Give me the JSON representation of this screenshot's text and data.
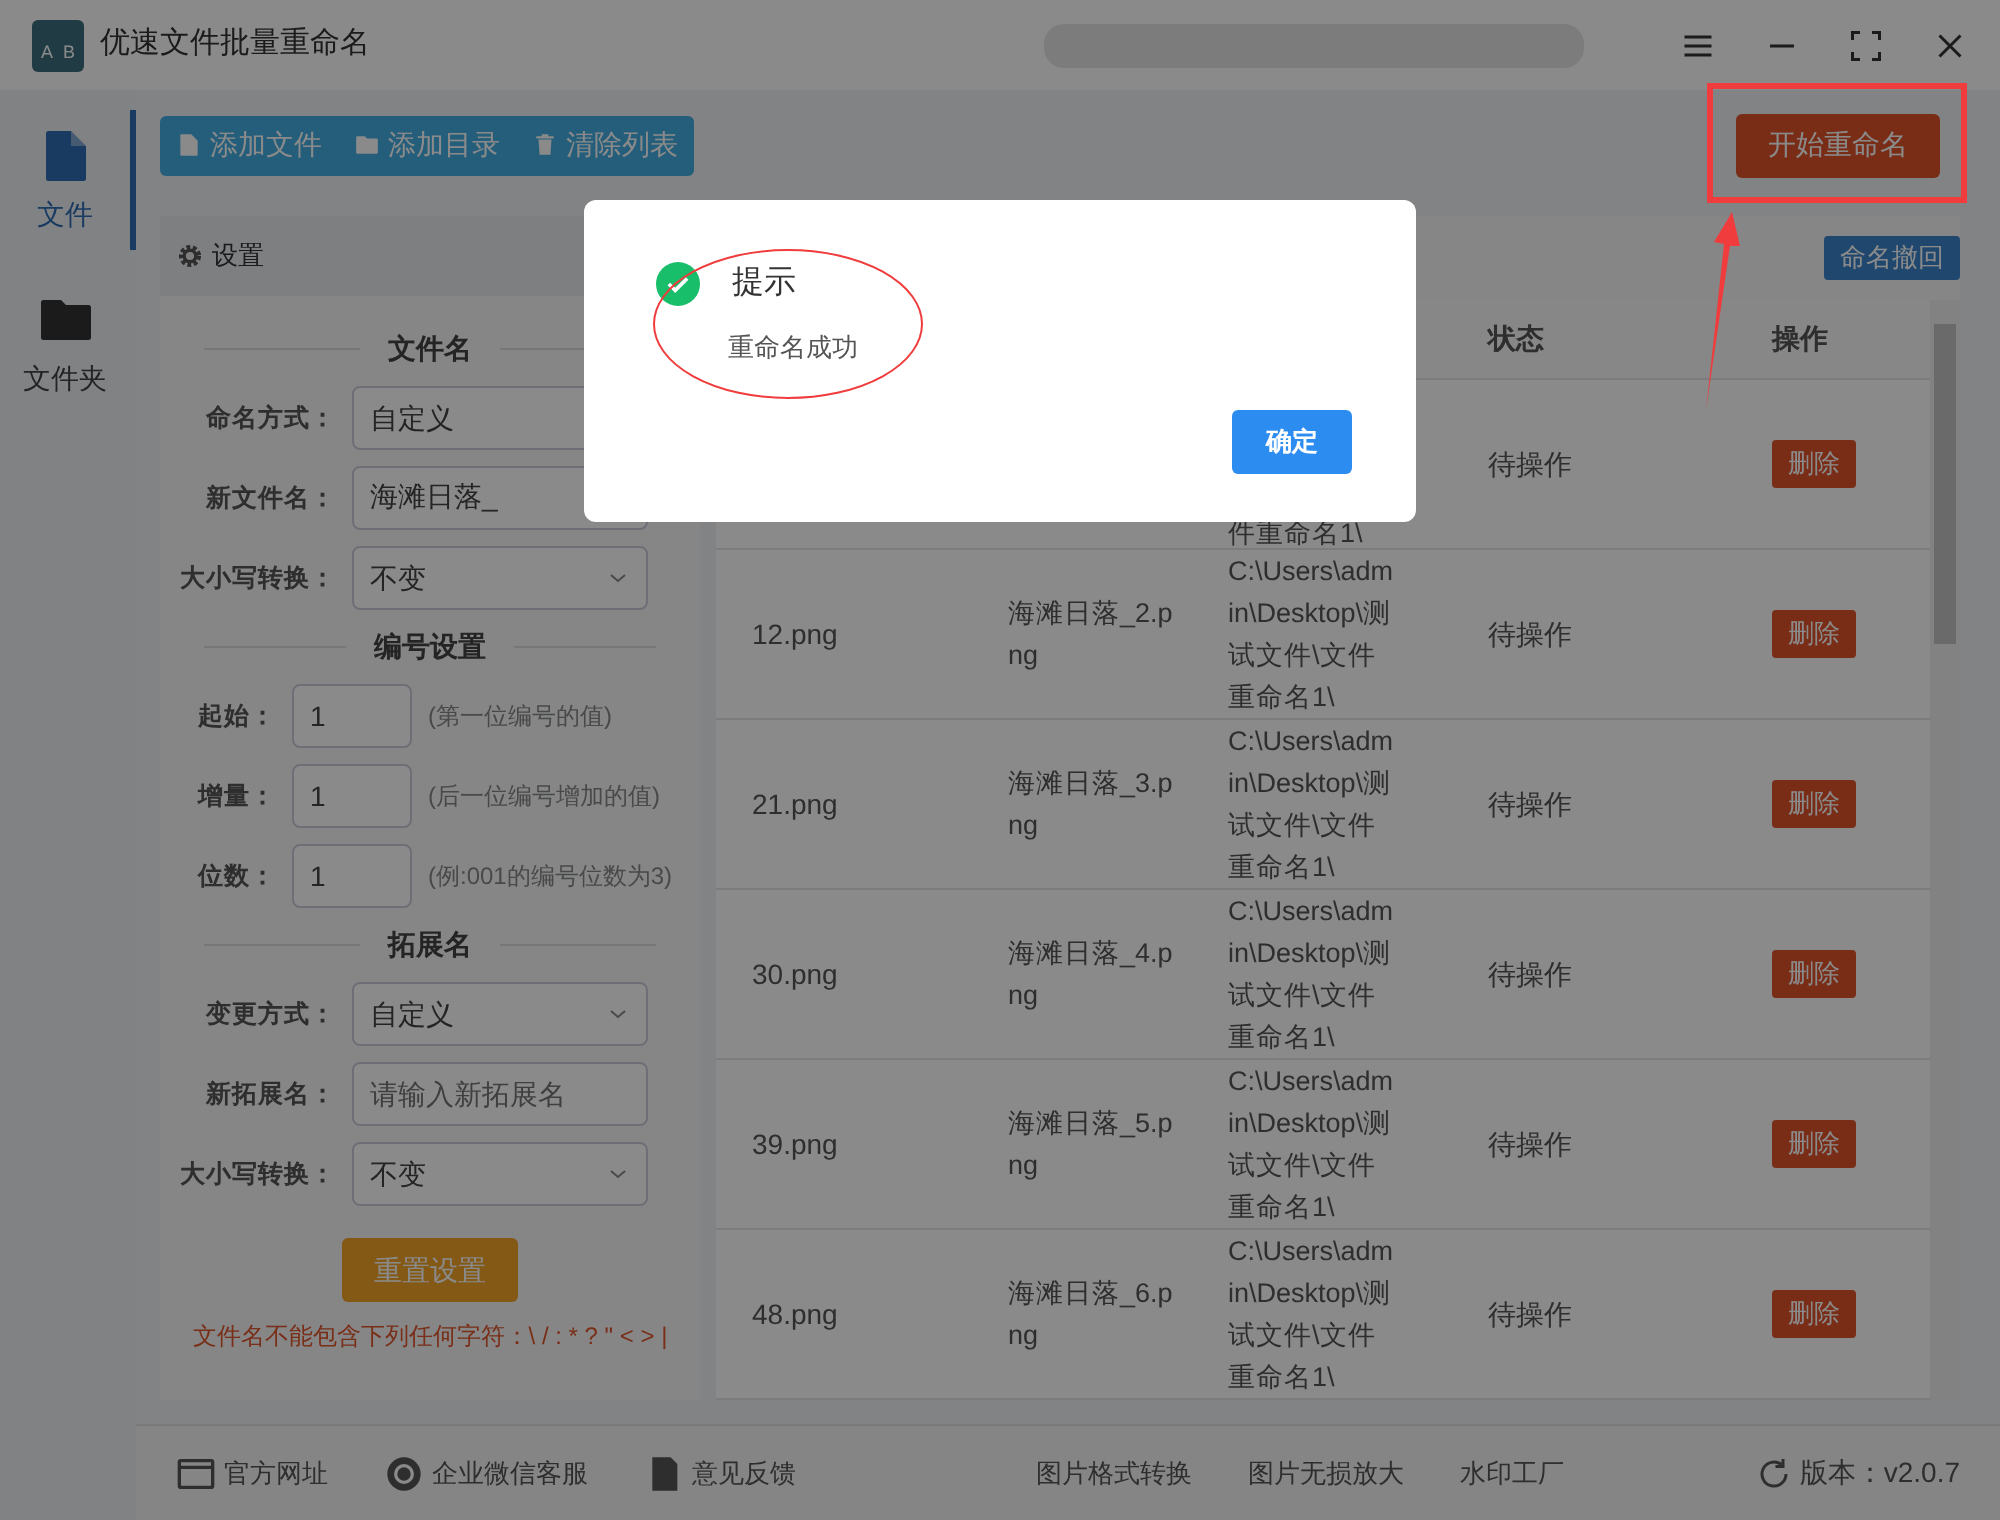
{
  "window": {
    "title": "优速文件批量重命名",
    "logo_letters": [
      "A",
      "B"
    ]
  },
  "toolbar": {
    "buttons": [
      {
        "label": "添加文件",
        "kind": "file"
      },
      {
        "label": "添加目录",
        "kind": "folder"
      },
      {
        "label": "清除列表",
        "kind": "trash"
      }
    ],
    "start_button": "开始重命名"
  },
  "sidebar": {
    "items": [
      {
        "label": "文件",
        "kind": "file",
        "selected": true
      },
      {
        "label": "文件夹",
        "kind": "folder",
        "selected": false
      }
    ]
  },
  "settings": {
    "title": "设置",
    "sections": [
      {
        "title": "文件名",
        "fields": [
          {
            "kind": "select",
            "label": "命名方式：",
            "value": "自定义"
          },
          {
            "kind": "text",
            "label": "新文件名：",
            "value": "海滩日落_"
          },
          {
            "kind": "select",
            "label": "大小写转换：",
            "value": "不变"
          }
        ]
      },
      {
        "title": "编号设置",
        "fields": [
          {
            "kind": "number",
            "label": "起始：",
            "value": "1",
            "hint": "(第一位编号的值)"
          },
          {
            "kind": "number",
            "label": "增量：",
            "value": "1",
            "hint": "(后一位编号增加的值)"
          },
          {
            "kind": "number",
            "label": "位数：",
            "value": "1",
            "hint": "(例:001的编号位数为3)"
          }
        ]
      },
      {
        "title": "拓展名",
        "fields": [
          {
            "kind": "select",
            "label": "变更方式：",
            "value": "自定义"
          },
          {
            "kind": "text",
            "label": "新拓展名：",
            "placeholder": "请输入新拓展名"
          },
          {
            "kind": "select",
            "label": "大小写转换：",
            "value": "不变"
          }
        ]
      }
    ],
    "reset_button": "重置设置",
    "warning": "文件名不能包含下列任何字符：\\ / : * ? \" < > |"
  },
  "table": {
    "undo_button": "命名撤回",
    "columns": {
      "status": "状态",
      "action": "操作"
    },
    "rows": [
      {
        "path": "件重命名1\\",
        "status": "待操作",
        "action": "删除"
      },
      {
        "file": "12.png",
        "new_name": "海滩日落_2.png",
        "path": "C:\\Users\\admin\\Desktop\\测试文件\\文件重命名1\\",
        "status": "待操作",
        "action": "删除"
      },
      {
        "file": "21.png",
        "new_name": "海滩日落_3.png",
        "path": "C:\\Users\\admin\\Desktop\\测试文件\\文件重命名1\\",
        "status": "待操作",
        "action": "删除"
      },
      {
        "file": "30.png",
        "new_name": "海滩日落_4.png",
        "path": "C:\\Users\\admin\\Desktop\\测试文件\\文件重命名1\\",
        "status": "待操作",
        "action": "删除"
      },
      {
        "file": "39.png",
        "new_name": "海滩日落_5.png",
        "path": "C:\\Users\\admin\\Desktop\\测试文件\\文件重命名1\\",
        "status": "待操作",
        "action": "删除"
      },
      {
        "file": "48.png",
        "new_name": "海滩日落_6.png",
        "path": "C:\\Users\\admin\\Desktop\\测试文件\\文件重命名1\\",
        "status": "待操作",
        "action": "删除"
      }
    ]
  },
  "footer": {
    "links": [
      {
        "label": "官方网址",
        "kind": "web"
      },
      {
        "label": "企业微信客服",
        "kind": "chat"
      },
      {
        "label": "意见反馈",
        "kind": "doc"
      },
      {
        "label": "图片格式转换"
      },
      {
        "label": "图片无损放大"
      },
      {
        "label": "水印工厂"
      }
    ],
    "version": "版本：v2.0.7"
  },
  "dialog": {
    "title": "提示",
    "message": "重命名成功",
    "confirm": "确定"
  }
}
